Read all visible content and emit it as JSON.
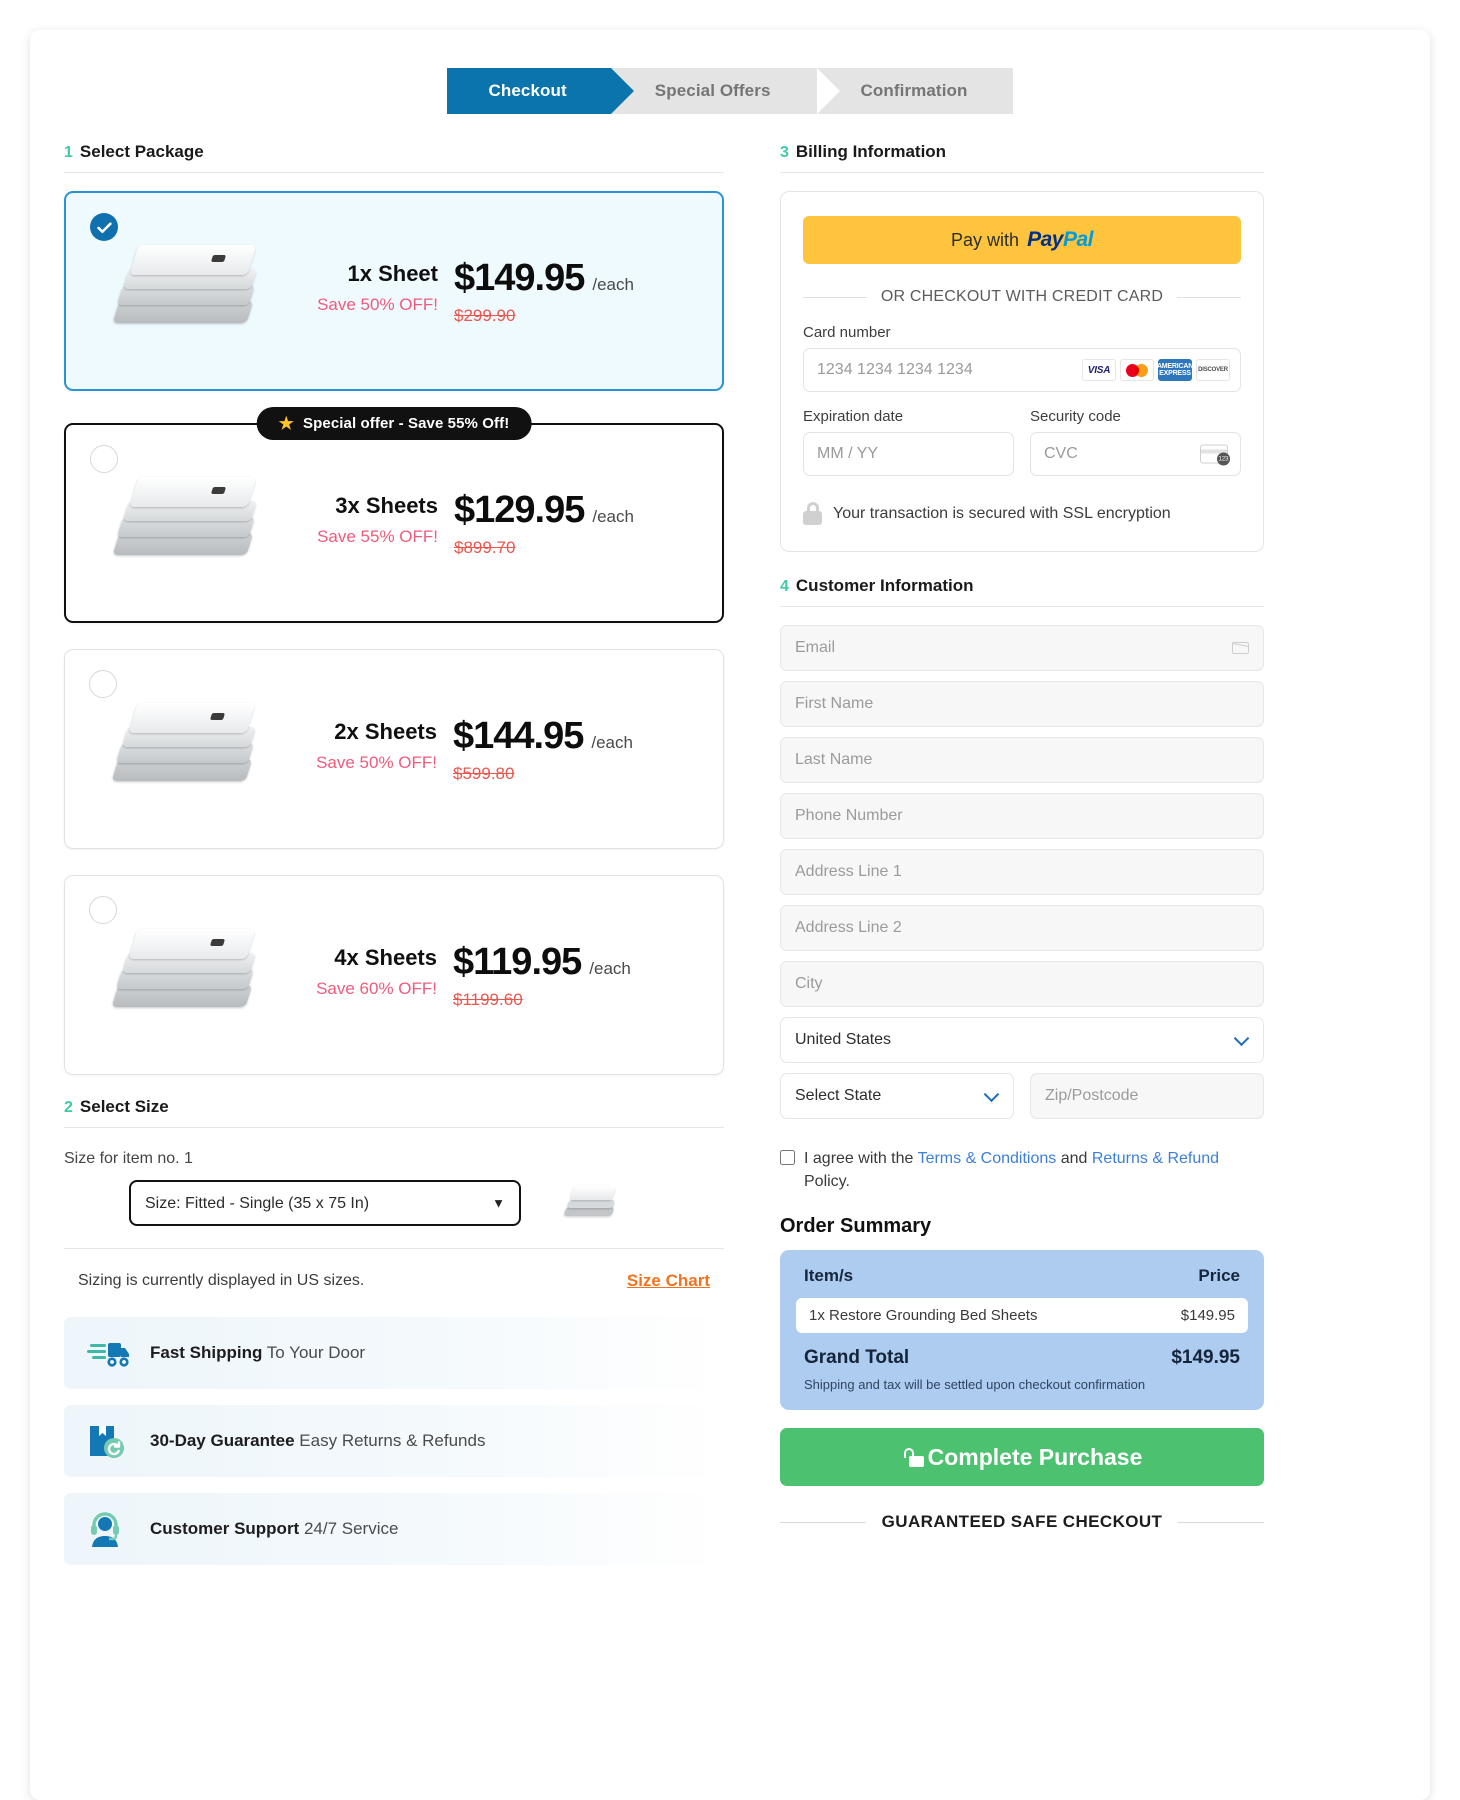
{
  "steps": [
    {
      "label": "Checkout",
      "state": "active"
    },
    {
      "label": "Special Offers",
      "state": "idle"
    },
    {
      "label": "Confirmation",
      "state": "idle"
    }
  ],
  "sections": {
    "select_package": {
      "num": "1",
      "title": "Select Package"
    },
    "select_size": {
      "num": "2",
      "title": "Select Size"
    },
    "billing": {
      "num": "3",
      "title": "Billing Information"
    },
    "customer": {
      "num": "4",
      "title": "Customer Information"
    }
  },
  "packages": [
    {
      "title": "1x Sheet",
      "save": "Save 50% OFF!",
      "price": "$149.95",
      "each": "/each",
      "old_price": "$299.90",
      "selected": true,
      "ribbon": null
    },
    {
      "title": "3x Sheets",
      "save": "Save 55% OFF!",
      "price": "$129.95",
      "each": "/each",
      "old_price": "$899.70",
      "selected": false,
      "ribbon": "Special offer - Save 55% Off!"
    },
    {
      "title": "2x Sheets",
      "save": "Save 50% OFF!",
      "price": "$144.95",
      "each": "/each",
      "old_price": "$599.80",
      "selected": false,
      "ribbon": null
    },
    {
      "title": "4x Sheets",
      "save": "Save 60% OFF!",
      "price": "$119.95",
      "each": "/each",
      "old_price": "$1199.60",
      "selected": false,
      "ribbon": null
    }
  ],
  "size": {
    "item_label": "Size for item no. 1",
    "selected": "Size: Fitted - Single (35 x 75 In)",
    "note": "Sizing is currently displayed in US sizes.",
    "chart_link": "Size Chart"
  },
  "trust": [
    {
      "icon": "truck-icon",
      "bold": "Fast Shipping",
      "rest": " To Your Door"
    },
    {
      "icon": "return-box-icon",
      "bold": "30-Day Guarantee",
      "rest": " Easy Returns & Refunds"
    },
    {
      "icon": "support-agent-icon",
      "bold": "Customer Support",
      "rest": " 24/7 Service"
    }
  ],
  "billing": {
    "paypal_prefix": "Pay with",
    "paypal_pay": "Pay",
    "paypal_pal": "Pal",
    "or_divider": "OR CHECKOUT WITH CREDIT CARD",
    "card_number_label": "Card number",
    "card_number_placeholder": "1234 1234 1234 1234",
    "expiry_label": "Expiration date",
    "expiry_placeholder": "MM / YY",
    "cvc_label": "Security code",
    "cvc_placeholder": "CVC",
    "brands": [
      "VISA",
      "mastercard",
      "AMERICAN EXPRESS",
      "DISCOVER"
    ],
    "ssl_text": "Your transaction is secured with SSL encryption"
  },
  "customer": {
    "email_placeholder": "Email",
    "first_name_placeholder": "First Name",
    "last_name_placeholder": "Last Name",
    "phone_placeholder": "Phone Number",
    "address1_placeholder": "Address Line 1",
    "address2_placeholder": "Address Line 2",
    "city_placeholder": "City",
    "country_value": "United States",
    "state_value": "Select State",
    "zip_placeholder": "Zip/Postcode"
  },
  "terms": {
    "pre": "I agree with the ",
    "link1": "Terms & Conditions",
    "mid": " and ",
    "link2": "Returns & Refund",
    "post": " Policy.",
    "checked": false
  },
  "order_summary": {
    "title": "Order Summary",
    "col_items": "Item/s",
    "col_price": "Price",
    "items": [
      {
        "name": "1x Restore Grounding Bed Sheets",
        "price": "$149.95"
      }
    ],
    "total_label": "Grand Total",
    "total_value": "$149.95",
    "note": "Shipping and tax will be settled upon checkout confirmation"
  },
  "cta": {
    "label": "Complete Purchase"
  },
  "footer": {
    "safe_checkout": "GUARANTEED SAFE CHECKOUT"
  },
  "colors": {
    "accent_blue": "#0b74ac",
    "step_idle": "#e4e4e4",
    "green_num": "#3fc9a8",
    "pink_save": "#ef5b7c",
    "old_price_red": "#e8574e",
    "orange_link": "#f0731f",
    "paypal_yellow": "#ffc43d",
    "summary_blue": "#aecbf0",
    "cta_green": "#4cc270"
  }
}
